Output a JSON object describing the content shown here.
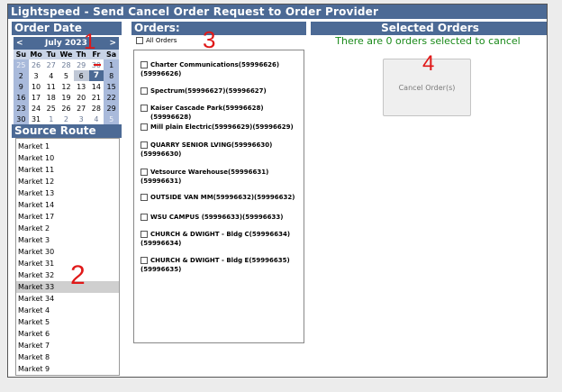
{
  "window": {
    "title": "Lightspeed - Send Cancel Order Request to Order Provider"
  },
  "order_date": {
    "header": "Order Date",
    "month_label": "July 2023",
    "prev": "<",
    "next": ">",
    "weekdays": [
      "Su",
      "Mo",
      "Tu",
      "We",
      "Th",
      "Fr",
      "Sa"
    ],
    "weeks": [
      [
        "25",
        "26",
        "27",
        "28",
        "29",
        "30",
        "1"
      ],
      [
        "2",
        "3",
        "4",
        "5",
        "6",
        "7",
        "8"
      ],
      [
        "9",
        "10",
        "11",
        "12",
        "13",
        "14",
        "15"
      ],
      [
        "16",
        "17",
        "18",
        "19",
        "20",
        "21",
        "22"
      ],
      [
        "23",
        "24",
        "25",
        "26",
        "27",
        "28",
        "29"
      ],
      [
        "30",
        "31",
        "1",
        "2",
        "3",
        "4",
        "5"
      ]
    ],
    "selected_day": "7"
  },
  "source_route": {
    "header": "Source Route",
    "items": [
      "Market 1",
      "Market 10",
      "Market 11",
      "Market 12",
      "Market 13",
      "Market 14",
      "Market 17",
      "Market 2",
      "Market 3",
      "Market 30",
      "Market 31",
      "Market 32",
      "Market 33",
      "Market 34",
      "Market 4",
      "Market 5",
      "Market 6",
      "Market 7",
      "Market 8",
      "Market 9"
    ],
    "selected": "Market 33"
  },
  "orders": {
    "header": "Orders:",
    "all_label": "All Orders",
    "items": [
      {
        "line1": "Charter Communications(59996626)",
        "line2": "(59996626)"
      },
      {
        "line1": "Spectrum(59996627)(59996627)",
        "line2": ""
      },
      {
        "line1": "Kaiser Cascade Park(59996628)(59996628)",
        "line2": ""
      },
      {
        "line1": "Mill plain Electric(59996629)(59996629)",
        "line2": ""
      },
      {
        "line1": "QUARRY SENIOR LVING(59996630)",
        "line2": "(59996630)"
      },
      {
        "line1": "Vetsource Warehouse(59996631)",
        "line2": "(59996631)"
      },
      {
        "line1": "OUTSIDE VAN MM(59996632)(59996632)",
        "line2": ""
      },
      {
        "line1": "WSU CAMPUS (59996633)(59996633)",
        "line2": ""
      },
      {
        "line1": "CHURCH & DWIGHT - Bldg C(59996634)",
        "line2": "(59996634)"
      },
      {
        "line1": "CHURCH & DWIGHT - Bldg E(59996635)",
        "line2": "(59996635)"
      }
    ]
  },
  "selected_orders": {
    "header": "Selected Orders",
    "message": "There are 0 orders selected to cancel",
    "cancel_label": "Cancel Order(s)"
  },
  "annotations": [
    "1",
    "2",
    "3",
    "4"
  ],
  "colors": {
    "header_bg": "#4c6a95",
    "message": "#1a8a1a",
    "annotation": "#e01818"
  }
}
